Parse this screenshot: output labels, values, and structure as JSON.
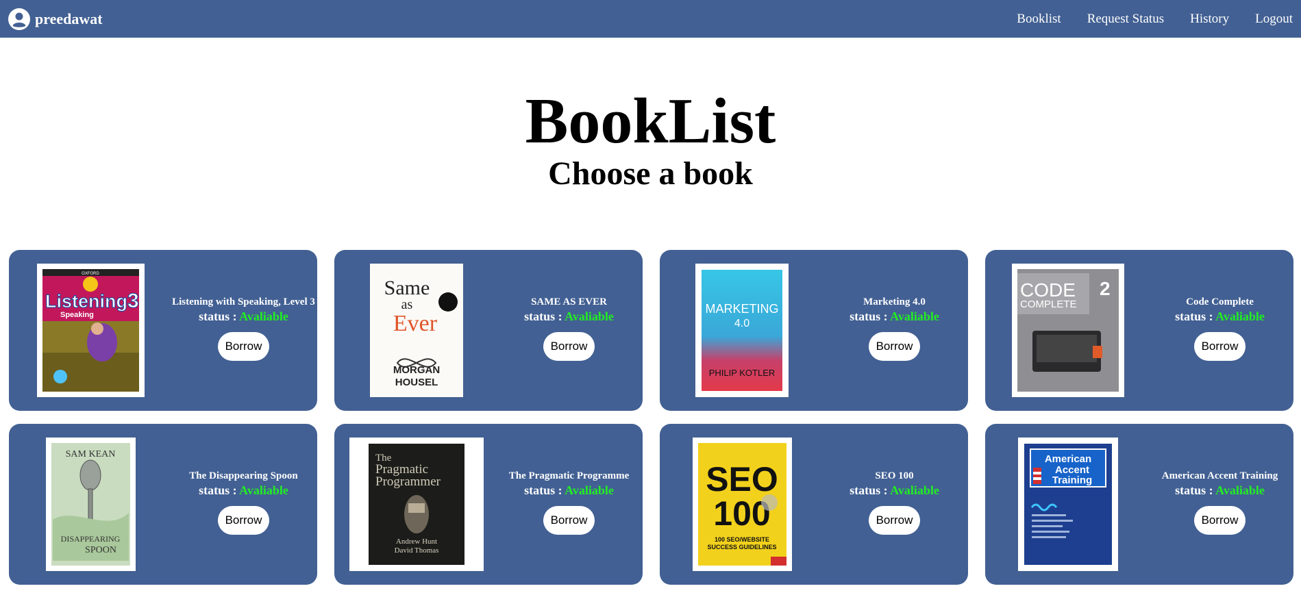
{
  "nav": {
    "username": "preedawat",
    "links": [
      "Booklist",
      "Request Status",
      "History",
      "Logout"
    ]
  },
  "header": {
    "title": "BookList",
    "subtitle": "Choose a book"
  },
  "status_label": "status :",
  "books": [
    {
      "title": "Listening with Speaking, Level 3",
      "status": "Avaliable",
      "button": "Borrow",
      "cover": {
        "c1": "Listening",
        "c2": "Speaking",
        "c3": "3",
        "c4": "OXFORD"
      }
    },
    {
      "title": "SAME AS EVER",
      "status": "Avaliable",
      "button": "Borrow",
      "cover": {
        "c1": "Same",
        "c2": "as",
        "c3": "Ever",
        "c4": "MORGAN",
        "c5": "HOUSEL"
      }
    },
    {
      "title": "Marketing 4.0",
      "status": "Avaliable",
      "button": "Borrow",
      "cover": {
        "c1": "MARKETING",
        "c2": "4.0",
        "c3": "PHILIP KOTLER"
      }
    },
    {
      "title": "Code Complete",
      "status": "Avaliable",
      "button": "Borrow",
      "cover": {
        "c1": "CODE",
        "c2": "COMPLETE",
        "c3": "2"
      }
    },
    {
      "title": "The Disappearing Spoon",
      "status": "Avaliable",
      "button": "Borrow",
      "cover": {
        "c1": "SAM KEAN",
        "c2": "DISAPPEARING",
        "c3": "SPOON"
      }
    },
    {
      "title": "The Pragmatic Programme",
      "status": "Avaliable",
      "button": "Borrow",
      "cover": {
        "c1": "The",
        "c2": "Pragmatic",
        "c3": "Programmer",
        "c4": "Andrew Hunt",
        "c5": "David Thomas"
      }
    },
    {
      "title": "SEO 100",
      "status": "Avaliable",
      "button": "Borrow",
      "cover": {
        "c1": "SEO",
        "c2": "100",
        "c3": "100 SEO/WEBSITE",
        "c4": "SUCCESS GUIDELINES"
      }
    },
    {
      "title": "American Accent Training",
      "status": "Avaliable",
      "button": "Borrow",
      "cover": {
        "c1": "American",
        "c2": "Accent",
        "c3": "Training"
      }
    }
  ],
  "colors": {
    "navbar": "#426093",
    "card": "#426093",
    "status_available": "#22ee22"
  },
  "icons": {
    "user": "user-circle-icon"
  }
}
